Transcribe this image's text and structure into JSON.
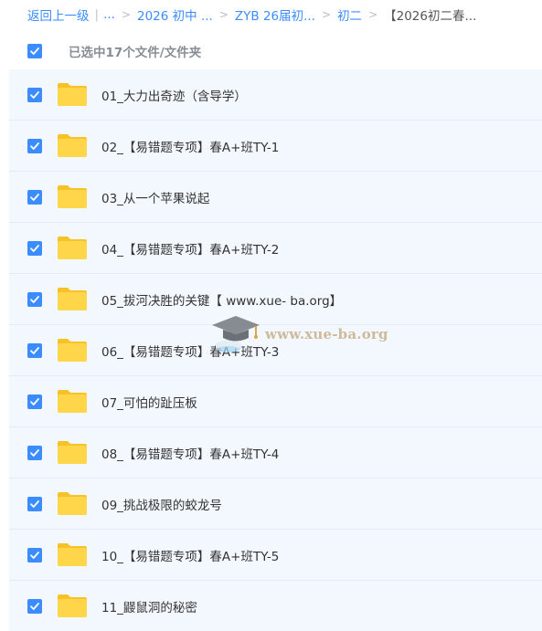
{
  "breadcrumb": {
    "back": "返回上一级",
    "bar": "|",
    "ellipsis": "...",
    "items": [
      "2026 初中 ...",
      "ZYB 26届初...",
      "初二"
    ],
    "current": "【2026初二春...",
    "separator": ">"
  },
  "header": {
    "select_all_checked": true,
    "selected_text": "已选中17个文件/文件夹"
  },
  "files": [
    {
      "name": "01_大力出奇迹（含导学）",
      "checked": true
    },
    {
      "name": "02_【易错题专项】春A+班TY-1",
      "checked": true
    },
    {
      "name": "03_从一个苹果说起",
      "checked": true
    },
    {
      "name": "04_【易错题专项】春A+班TY-2",
      "checked": true
    },
    {
      "name": "05_拔河决胜的关键【 www.xue- ba.org】",
      "checked": true
    },
    {
      "name": "06_【易错题专项】春A+班TY-3",
      "checked": true
    },
    {
      "name": "07_可怕的趾压板",
      "checked": true
    },
    {
      "name": "08_【易错题专项】春A+班TY-4",
      "checked": true
    },
    {
      "name": "09_挑战极限的蛟龙号",
      "checked": true
    },
    {
      "name": "10_【易错题专项】春A+班TY-5",
      "checked": true
    },
    {
      "name": "11_鼹鼠洞的秘密",
      "checked": true
    }
  ],
  "watermark": {
    "text": "www.xue-ba.org"
  },
  "colors": {
    "accent": "#3b8cff",
    "folder": "#ffd54a",
    "folder_dark": "#f5c227",
    "row_bg": "#f3f8fe"
  },
  "icons": {
    "checkbox": "check-icon",
    "folder": "folder-icon",
    "watermark": "graduation-cap-icon"
  }
}
